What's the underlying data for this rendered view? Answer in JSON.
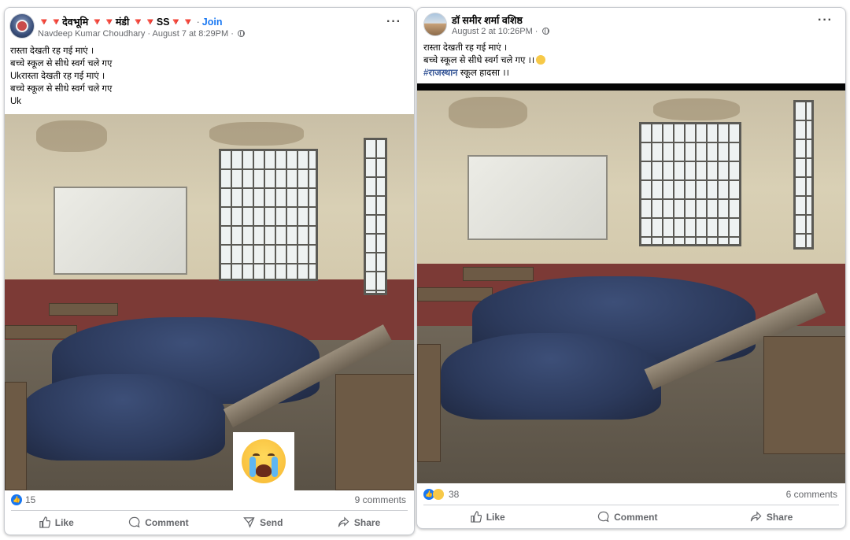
{
  "left_post": {
    "group_name": "🔻🔻देवभूमि 🔻🔻मंडी 🔻🔻SS🔻🔻",
    "join_label": "Join",
    "author": "Navdeep Kumar Choudhary",
    "timestamp": "August 7 at 8:29PM",
    "text_lines": [
      "रास्ता देखती रह गई माएं ।",
      "बच्चे स्कूल से सीधे स्वर्ग चले गए",
      "Ukरास्ता देखती रह गई माएं ।",
      "बच्चे स्कूल से सीधे स्वर्ग चले गए",
      "Uk"
    ],
    "reaction_count": "15",
    "comments": "9 comments",
    "actions": {
      "like": "Like",
      "comment": "Comment",
      "send": "Send",
      "share": "Share"
    }
  },
  "right_post": {
    "author": "डॉ समीर शर्मा वशिष्ठ",
    "timestamp": "August 2 at 10:26PM",
    "text_line1": "रास्ता देखती रह गई माएं ।",
    "text_line2": "बच्चे स्कूल से सीधे स्वर्ग चले गए ।।",
    "hashtag": "#राजस्थान",
    "text_line3_rest": " स्कूल हादसा ।।",
    "reaction_count": "38",
    "comments": "6 comments",
    "actions": {
      "like": "Like",
      "comment": "Comment",
      "share": "Share"
    }
  },
  "colors": {
    "link": "#1877f2",
    "hashtag": "#385898",
    "muted": "#65676b"
  },
  "icons": [
    "more-options-icon",
    "globe-icon",
    "like-reaction-icon",
    "sad-reaction-icon",
    "crying-face-emoji",
    "like-icon",
    "comment-icon",
    "send-icon",
    "share-icon"
  ]
}
